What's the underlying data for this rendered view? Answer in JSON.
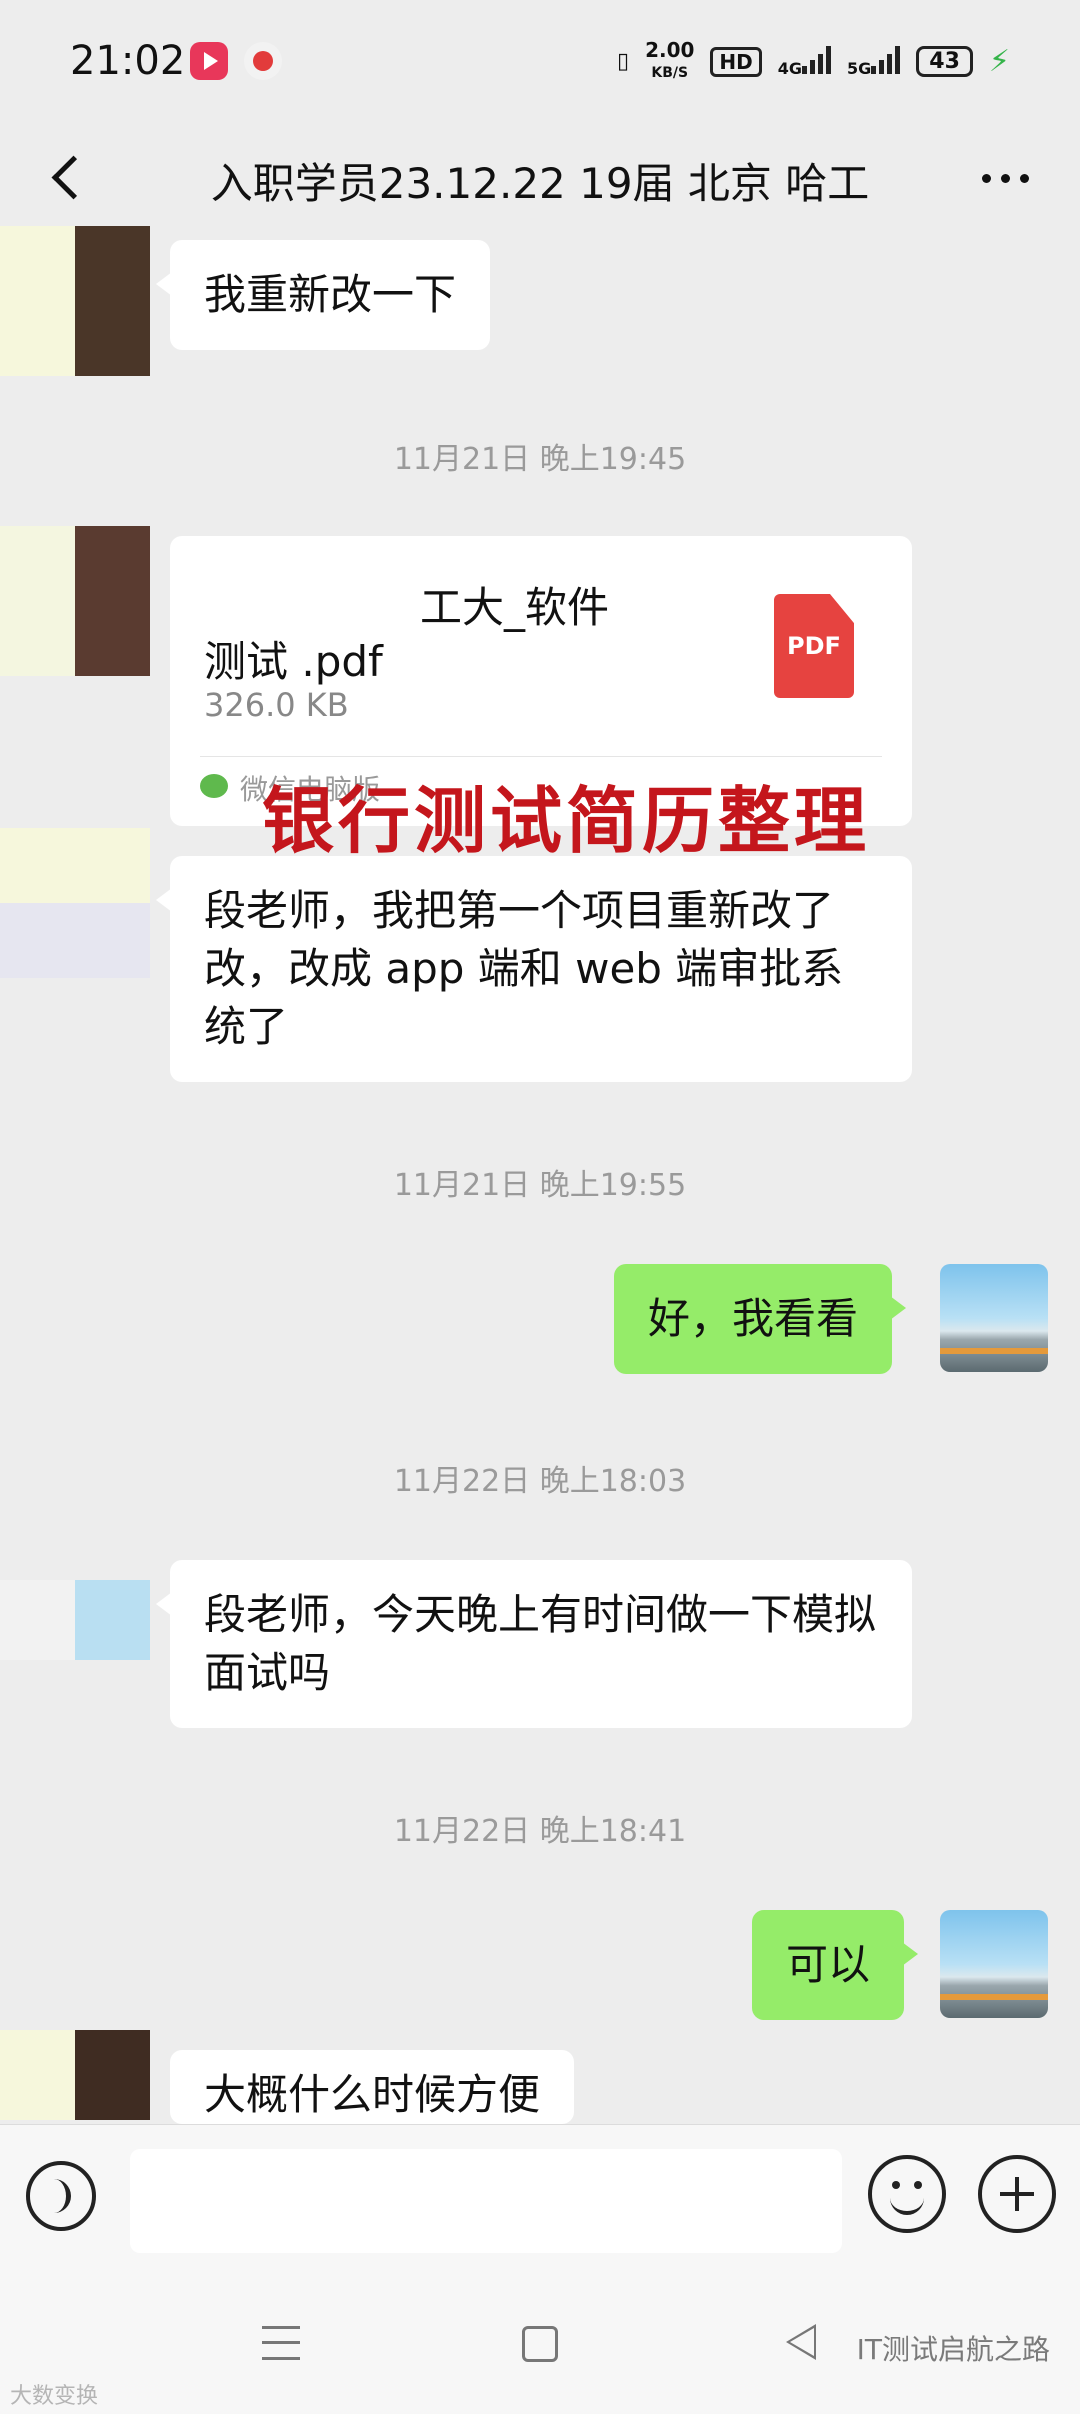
{
  "status_bar": {
    "time": "21:02",
    "net_speed_value": "2.00",
    "net_speed_unit": "KB/S",
    "hd": "HD",
    "net_4g": "4G",
    "net_5g": "5G",
    "battery": "43"
  },
  "header": {
    "title": "入职学员23.12.22 19届 北京 哈工"
  },
  "messages": [
    {
      "type": "text",
      "side": "left",
      "text": "我重新改一下"
    },
    {
      "type": "timestamp",
      "text": "11月21日 晚上19:45"
    },
    {
      "type": "file",
      "side": "left",
      "name_line1": "工大_软件",
      "name_line2": "测试 .pdf",
      "size": "326.0 KB",
      "source": "微信电脑版",
      "icon_label": "PDF"
    },
    {
      "type": "text",
      "side": "left",
      "text": "段老师，我把第一个项目重新改了改，改成 app 端和 web 端审批系统了"
    },
    {
      "type": "timestamp",
      "text": "11月21日 晚上19:55"
    },
    {
      "type": "text",
      "side": "right",
      "text": "好，我看看"
    },
    {
      "type": "timestamp",
      "text": "11月22日 晚上18:03"
    },
    {
      "type": "text",
      "side": "left",
      "text": "段老师，今天晚上有时间做一下模拟面试吗"
    },
    {
      "type": "timestamp",
      "text": "11月22日 晚上18:41"
    },
    {
      "type": "text",
      "side": "right",
      "text": "可以"
    },
    {
      "type": "text",
      "side": "left",
      "text": "大概什么时候方便"
    }
  ],
  "overlay_title": "银行测试简历整理",
  "input": {
    "placeholder": ""
  },
  "watermarks": {
    "right": "IT测试启航之路",
    "left": "大数变换"
  }
}
